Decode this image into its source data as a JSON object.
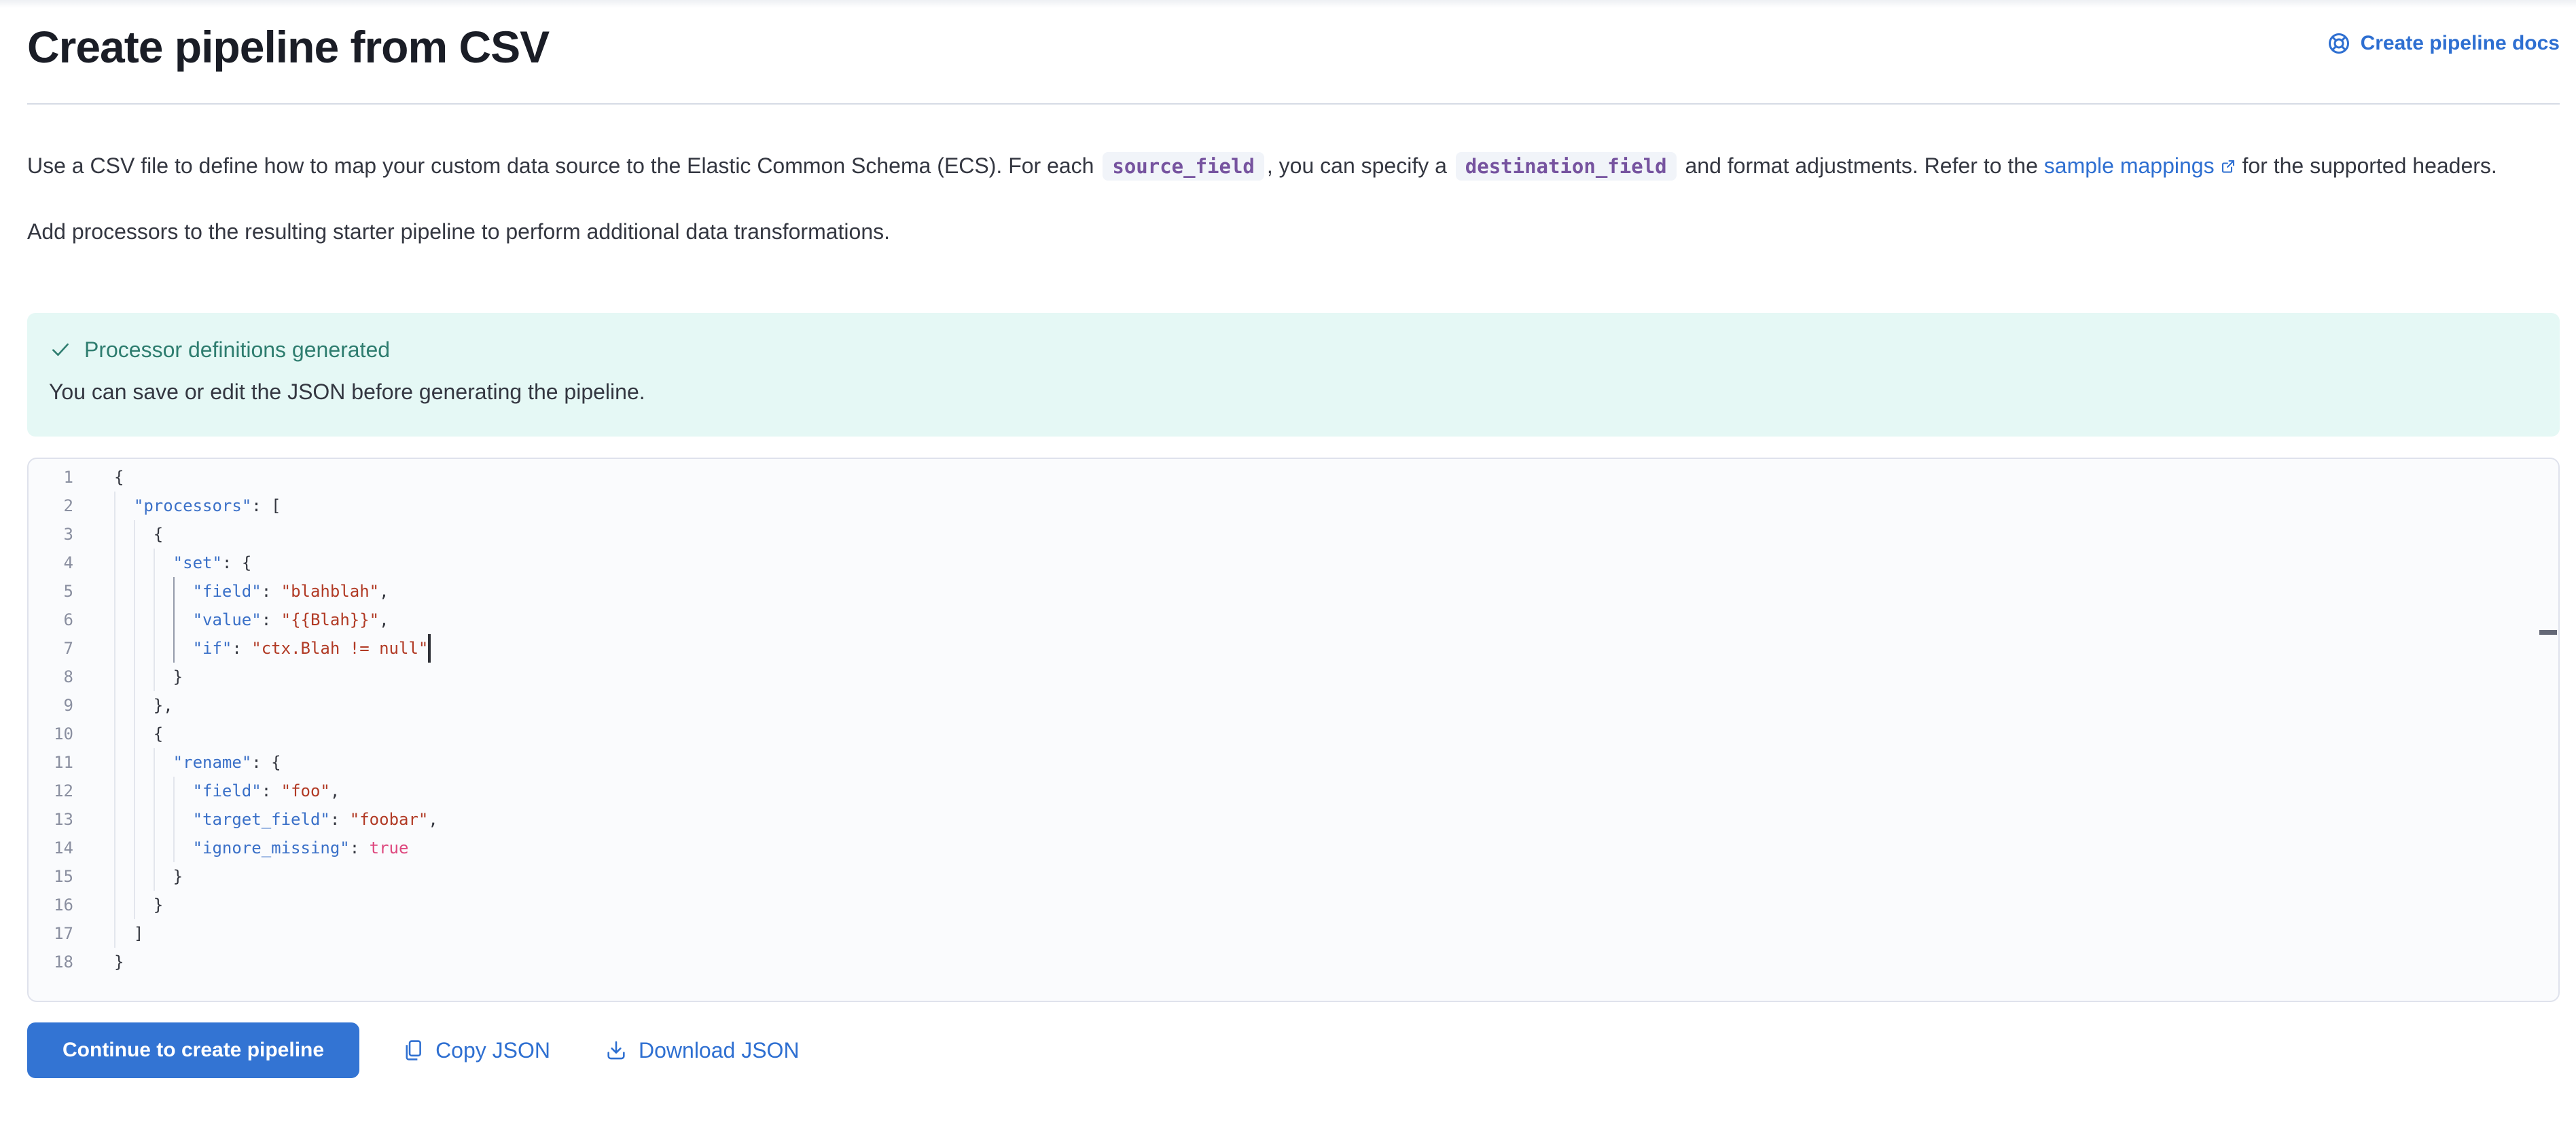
{
  "page": {
    "title": "Create pipeline from CSV"
  },
  "header": {
    "docs_link_label": "Create pipeline docs",
    "docs_link_icon": "help-ring-icon"
  },
  "intro": {
    "p1_parts": [
      {
        "type": "text",
        "text": "Use a CSV file to define how to map your custom data source to the Elastic Common Schema (ECS). For each "
      },
      {
        "type": "code",
        "text": "source_field"
      },
      {
        "type": "text",
        "text": ", you can specify a "
      },
      {
        "type": "code",
        "text": "destination_field"
      },
      {
        "type": "text",
        "text": " and format adjustments. Refer to the "
      },
      {
        "type": "link",
        "text": "sample mappings",
        "external": true
      },
      {
        "type": "text",
        "text": " for the supported headers."
      }
    ],
    "p2": "Add processors to the resulting starter pipeline to perform additional data transformations."
  },
  "callout": {
    "icon": "check-icon",
    "title": "Processor definitions generated",
    "body": "You can save or edit the JSON before generating the pipeline."
  },
  "editor": {
    "cursor_line": 7,
    "active_guide_lines": [
      5,
      6,
      7
    ],
    "lines": [
      {
        "num": 1,
        "indent": 0,
        "tokens": [
          {
            "c": "p",
            "t": "{"
          }
        ]
      },
      {
        "num": 2,
        "indent": 2,
        "tokens": [
          {
            "c": "k",
            "t": "\"processors\""
          },
          {
            "c": "p",
            "t": ": ["
          }
        ]
      },
      {
        "num": 3,
        "indent": 4,
        "tokens": [
          {
            "c": "p",
            "t": "{"
          }
        ]
      },
      {
        "num": 4,
        "indent": 6,
        "tokens": [
          {
            "c": "k",
            "t": "\"set\""
          },
          {
            "c": "p",
            "t": ": {"
          }
        ]
      },
      {
        "num": 5,
        "indent": 8,
        "tokens": [
          {
            "c": "k",
            "t": "\"field\""
          },
          {
            "c": "p",
            "t": ": "
          },
          {
            "c": "s",
            "t": "\"blahblah\""
          },
          {
            "c": "p",
            "t": ","
          }
        ]
      },
      {
        "num": 6,
        "indent": 8,
        "tokens": [
          {
            "c": "k",
            "t": "\"value\""
          },
          {
            "c": "p",
            "t": ": "
          },
          {
            "c": "s",
            "t": "\"{{Blah}}\""
          },
          {
            "c": "p",
            "t": ","
          }
        ]
      },
      {
        "num": 7,
        "indent": 8,
        "tokens": [
          {
            "c": "k",
            "t": "\"if\""
          },
          {
            "c": "p",
            "t": ": "
          },
          {
            "c": "s",
            "t": "\"ctx.Blah != null\""
          }
        ]
      },
      {
        "num": 8,
        "indent": 6,
        "tokens": [
          {
            "c": "p",
            "t": "}"
          }
        ]
      },
      {
        "num": 9,
        "indent": 4,
        "tokens": [
          {
            "c": "p",
            "t": "},"
          }
        ]
      },
      {
        "num": 10,
        "indent": 4,
        "tokens": [
          {
            "c": "p",
            "t": "{"
          }
        ]
      },
      {
        "num": 11,
        "indent": 6,
        "tokens": [
          {
            "c": "k",
            "t": "\"rename\""
          },
          {
            "c": "p",
            "t": ": {"
          }
        ]
      },
      {
        "num": 12,
        "indent": 8,
        "tokens": [
          {
            "c": "k",
            "t": "\"field\""
          },
          {
            "c": "p",
            "t": ": "
          },
          {
            "c": "s",
            "t": "\"foo\""
          },
          {
            "c": "p",
            "t": ","
          }
        ]
      },
      {
        "num": 13,
        "indent": 8,
        "tokens": [
          {
            "c": "k",
            "t": "\"target_field\""
          },
          {
            "c": "p",
            "t": ": "
          },
          {
            "c": "s",
            "t": "\"foobar\""
          },
          {
            "c": "p",
            "t": ","
          }
        ]
      },
      {
        "num": 14,
        "indent": 8,
        "tokens": [
          {
            "c": "k",
            "t": "\"ignore_missing\""
          },
          {
            "c": "p",
            "t": ": "
          },
          {
            "c": "b",
            "t": "true"
          }
        ]
      },
      {
        "num": 15,
        "indent": 6,
        "tokens": [
          {
            "c": "p",
            "t": "}"
          }
        ]
      },
      {
        "num": 16,
        "indent": 4,
        "tokens": [
          {
            "c": "p",
            "t": "}"
          }
        ]
      },
      {
        "num": 17,
        "indent": 2,
        "tokens": [
          {
            "c": "p",
            "t": "]"
          }
        ]
      },
      {
        "num": 18,
        "indent": 0,
        "tokens": [
          {
            "c": "p",
            "t": "}"
          }
        ]
      }
    ]
  },
  "actions": {
    "continue": "Continue to create pipeline",
    "copy": "Copy JSON",
    "copy_icon": "copy-icon",
    "download": "Download JSON",
    "download_icon": "download-icon"
  },
  "colors": {
    "link": "#2e6fd1",
    "primary_button": "#3374d3",
    "callout_bg": "#e5f8f5",
    "callout_title": "#2e7d6f",
    "inline_code_text": "#76539f",
    "token_key": "#3a70c8",
    "token_string": "#b13a25",
    "token_boolean": "#de477e",
    "editor_bg": "#fafbfd",
    "title_text": "#1a1d26",
    "body_text": "#343741"
  }
}
